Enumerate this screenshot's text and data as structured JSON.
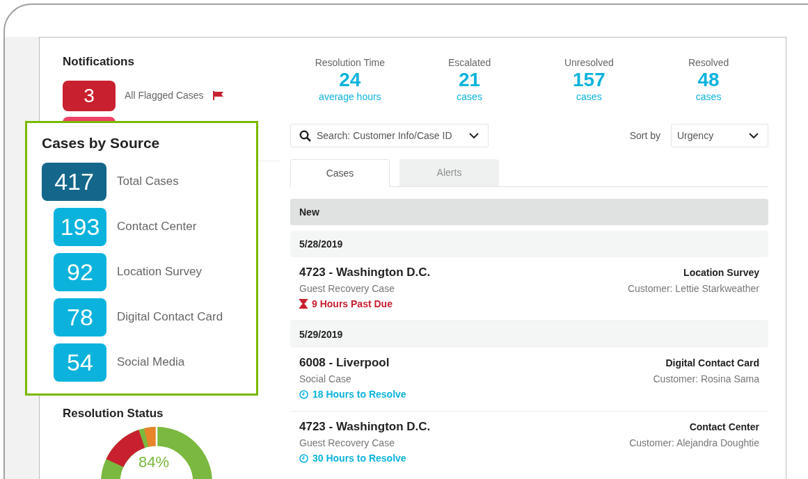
{
  "notifications": {
    "title": "Notifications",
    "items": [
      {
        "count": "3",
        "label": "All Flagged Cases",
        "flagged": true,
        "color": "#c8202f"
      },
      {
        "color": "#ee4266"
      }
    ]
  },
  "resolution_status": {
    "title": "Resolution Status",
    "center_label": "84%"
  },
  "stats": [
    {
      "label": "Resolution Time",
      "value": "24",
      "unit": "average hours"
    },
    {
      "label": "Escalated",
      "value": "21",
      "unit": "cases"
    },
    {
      "label": "Unresolved",
      "value": "157",
      "unit": "cases"
    },
    {
      "label": "Resolved",
      "value": "48",
      "unit": "cases"
    }
  ],
  "search": {
    "placeholder": "Search: Customer Info/Case ID"
  },
  "sort": {
    "label": "Sort by",
    "value": "Urgency"
  },
  "tabs": [
    {
      "label": "Cases",
      "selected": true
    },
    {
      "label": "Alerts",
      "selected": false
    }
  ],
  "case_list": [
    {
      "kind": "header",
      "label": "New"
    },
    {
      "kind": "date",
      "label": "5/28/2019"
    },
    {
      "kind": "case",
      "title": "4723 - Washington D.C.",
      "type": "Guest Recovery Case",
      "source": "Location Survey",
      "customer": "Customer: Lettie Starkweather",
      "due": "9 Hours Past Due",
      "overdue": true
    },
    {
      "kind": "date",
      "label": "5/29/2019"
    },
    {
      "kind": "case",
      "title": "6008 - Liverpool",
      "type": "Social Case",
      "source": "Digital Contact Card",
      "customer": "Customer: Rosina Sama",
      "due": "18 Hours to Resolve",
      "overdue": false
    },
    {
      "kind": "case",
      "title": "4723 - Washington D.C.",
      "type": "Guest Recovery Case",
      "source": "Contact Center",
      "customer": "Customer: Alejandra Doughtie",
      "due": "30 Hours to Resolve",
      "overdue": false
    }
  ],
  "cases_by_source": {
    "title": "Cases by Source",
    "items": [
      {
        "kind": "total",
        "count": "417",
        "label": "Total Cases"
      },
      {
        "kind": "source",
        "count": "193",
        "label": "Contact Center"
      },
      {
        "kind": "source",
        "count": "92",
        "label": "Location Survey"
      },
      {
        "kind": "source",
        "count": "78",
        "label": "Digital Contact Card"
      },
      {
        "kind": "source",
        "count": "54",
        "label": "Social Media"
      }
    ]
  }
}
